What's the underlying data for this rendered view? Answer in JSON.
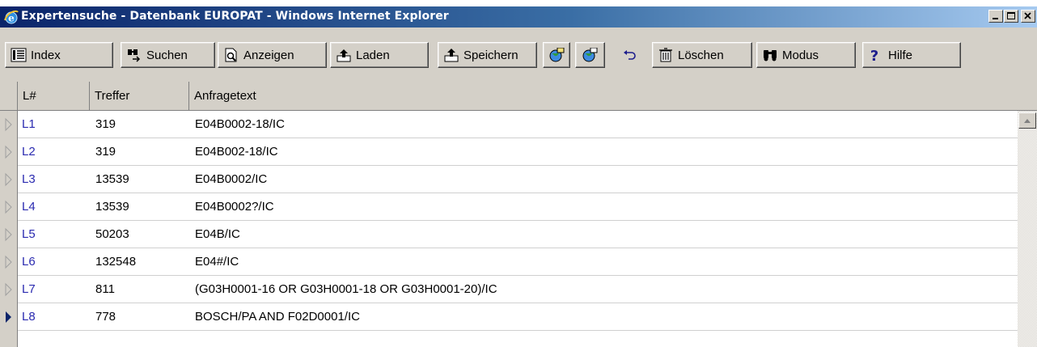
{
  "window": {
    "title": "Expertensuche - Datenbank EUROPAT - Windows Internet Explorer",
    "controls": [
      "minimize-icon",
      "maximize-icon",
      "close-icon"
    ]
  },
  "toolbar": {
    "index_label": "Index",
    "suchen_label": "Suchen",
    "anzeigen_label": "Anzeigen",
    "laden_label": "Laden",
    "speichern_label": "Speichern",
    "loeschen_label": "Löschen",
    "modus_label": "Modus",
    "hilfe_label": "Hilfe",
    "icons": [
      "list-icon",
      "binoculars-search-icon",
      "document-view-icon",
      "load-icon",
      "save-icon",
      "globe-up-icon",
      "globe-down-icon",
      "undo-icon",
      "trash-icon",
      "binoculars-icon",
      "help-icon"
    ]
  },
  "grid": {
    "columns": [
      "L#",
      "Treffer",
      "Anfragetext"
    ],
    "rows": [
      {
        "id": "L1",
        "hits": "319",
        "query": "E04B0002-18/IC"
      },
      {
        "id": "L2",
        "hits": "319",
        "query": "E04B002-18/IC"
      },
      {
        "id": "L3",
        "hits": "13539",
        "query": "E04B0002/IC"
      },
      {
        "id": "L4",
        "hits": "13539",
        "query": "E04B0002?/IC"
      },
      {
        "id": "L5",
        "hits": "50203",
        "query": "E04B/IC"
      },
      {
        "id": "L6",
        "hits": "132548",
        "query": "E04#/IC"
      },
      {
        "id": "L7",
        "hits": "811",
        "query": "(G03H0001-16 OR G03H0001-18 OR G03H0001-20)/IC"
      },
      {
        "id": "L8",
        "hits": "778",
        "query": "BOSCH/PA AND F02D0001/IC"
      }
    ],
    "current_row": "L8"
  },
  "colors": {
    "title_start": "#0a246a",
    "title_end": "#a6caf0",
    "row_id": "#2a2ab0",
    "face": "#d4d0c8"
  }
}
